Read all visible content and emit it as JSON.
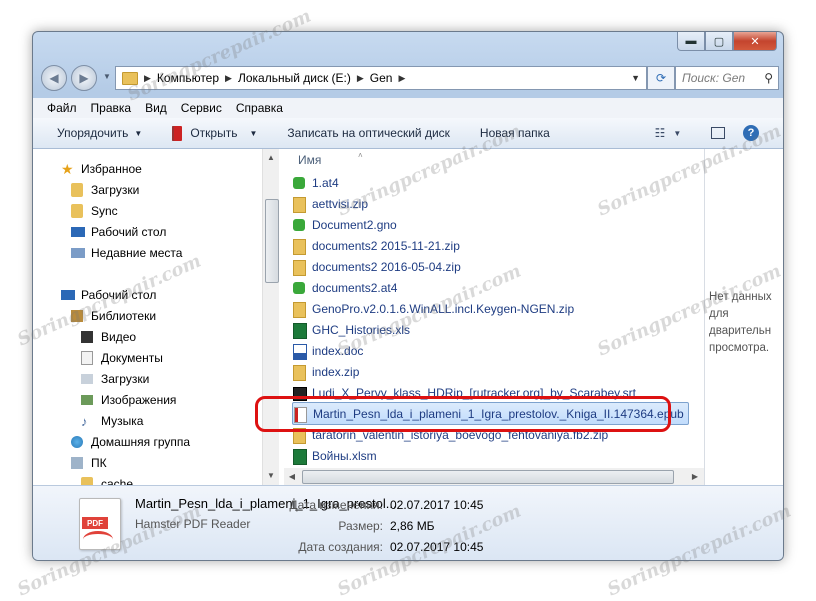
{
  "window": {
    "min": "▬",
    "max": "▢",
    "close": "✕"
  },
  "address": {
    "segments": [
      "Компьютер",
      "Локальный диск (E:)",
      "Gen"
    ]
  },
  "search": {
    "placeholder": "Поиск: Gen"
  },
  "menu": [
    "Файл",
    "Правка",
    "Вид",
    "Сервис",
    "Справка"
  ],
  "toolbar": {
    "organize": "Упорядочить",
    "open": "Открыть",
    "burn": "Записать на оптический диск",
    "new_folder": "Новая папка"
  },
  "nav": [
    {
      "label": "Избранное",
      "icon": "star-icon"
    },
    {
      "label": "Загрузки",
      "icon": "downloads-folder-icon"
    },
    {
      "label": "Sync",
      "icon": "folder-icon"
    },
    {
      "label": "Рабочий стол",
      "icon": "desktop-icon"
    },
    {
      "label": "Недавние места",
      "icon": "recent-places-icon"
    },
    {
      "label": "Рабочий стол",
      "icon": "desktop-icon"
    },
    {
      "label": "Библиотеки",
      "icon": "libraries-icon"
    },
    {
      "label": "Видео",
      "icon": "video-icon"
    },
    {
      "label": "Документы",
      "icon": "documents-icon"
    },
    {
      "label": "Загрузки",
      "icon": "downloads-icon"
    },
    {
      "label": "Изображения",
      "icon": "pictures-icon"
    },
    {
      "label": "Музыка",
      "icon": "music-icon"
    },
    {
      "label": "Домашняя группа",
      "icon": "homegroup-icon"
    },
    {
      "label": "ПК",
      "icon": "computer-icon"
    },
    {
      "label": "cache",
      "icon": "folder-icon"
    }
  ],
  "column": {
    "name": "Имя"
  },
  "files": [
    {
      "name": "1.at4",
      "icon": "genopro-icon"
    },
    {
      "name": "aettvisi.zip",
      "icon": "zip-icon"
    },
    {
      "name": "Document2.gno",
      "icon": "genopro-icon"
    },
    {
      "name": "documents2 2015-11-21.zip",
      "icon": "zip-icon"
    },
    {
      "name": "documents2 2016-05-04.zip",
      "icon": "zip-icon"
    },
    {
      "name": "documents2.at4",
      "icon": "genopro-icon"
    },
    {
      "name": "GenoPro.v2.0.1.6.WinALL.incl.Keygen-NGEN.zip",
      "icon": "zip-icon"
    },
    {
      "name": "GHC_Histories.xls",
      "icon": "excel-icon"
    },
    {
      "name": "index.doc",
      "icon": "word-icon"
    },
    {
      "name": "index.zip",
      "icon": "zip-icon"
    },
    {
      "name": "Ludi_X_Pervy_klass_HDRip_[rutracker.org]_by_Scarabey.srt",
      "icon": "subtitle-icon"
    },
    {
      "name": "Martin_Pesn_lda_i_plameni_1_Igra_prestolov._Kniga_II.147364.epub",
      "icon": "pdf-reader-icon"
    },
    {
      "name": "taratorin_valentin_istoriya_boevogo_fehtovaniya.fb2.zip",
      "icon": "zip-icon"
    },
    {
      "name": "Войны.xlsm",
      "icon": "excel-icon"
    }
  ],
  "preview": {
    "text": "Нет данных для предварительного просмотра.",
    "lines": [
      "Нет данных",
      "для",
      "дварительн",
      "просмотра."
    ]
  },
  "details": {
    "name": "Martin_Pesn_lda_i_plameni_1_Igra_prestol...",
    "app": "Hamster PDF Reader",
    "pdf_badge": "PDF",
    "modified_label": "Дата изменения:",
    "modified": "02.07.2017 10:45",
    "size_label": "Размер:",
    "size": "2,86 МБ",
    "created_label": "Дата создания:",
    "created": "02.07.2017 10:45"
  },
  "watermark": "Soringpcrepair.com"
}
